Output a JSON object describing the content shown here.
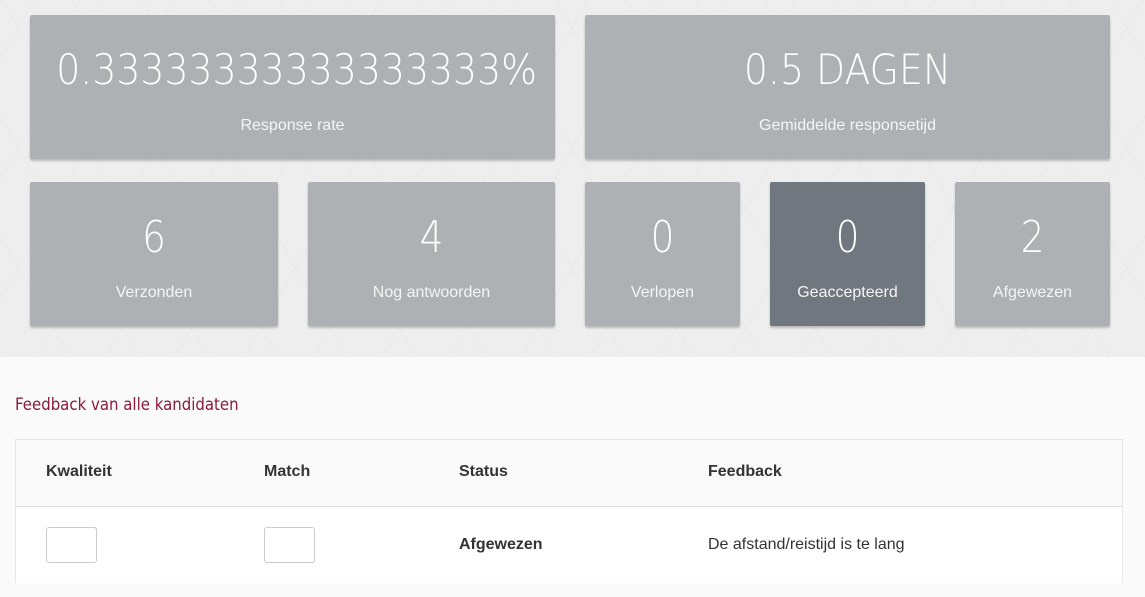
{
  "stats": {
    "response_rate": {
      "value": "0.33333333333333333%",
      "label": "Response rate"
    },
    "avg_response_time": {
      "value": "0.5 DAGEN",
      "label": "Gemiddelde responsetijd"
    },
    "sent": {
      "value": "6",
      "label": "Verzonden"
    },
    "pending": {
      "value": "4",
      "label": "Nog antwoorden"
    },
    "expired": {
      "value": "0",
      "label": "Verlopen"
    },
    "accepted": {
      "value": "0",
      "label": "Geaccepteerd"
    },
    "rejected": {
      "value": "2",
      "label": "Afgewezen"
    }
  },
  "feedback": {
    "title": "Feedback van alle kandidaten",
    "columns": {
      "quality": "Kwaliteit",
      "match": "Match",
      "status": "Status",
      "feedback": "Feedback"
    },
    "rows": [
      {
        "quality": "",
        "match": "",
        "status": "Afgewezen",
        "feedback": "De afstand/reistijd is te lang"
      }
    ]
  },
  "colors": {
    "card": "#aeb0b4",
    "card_active": "#71777f",
    "title_accent": "#8a1c3b"
  }
}
